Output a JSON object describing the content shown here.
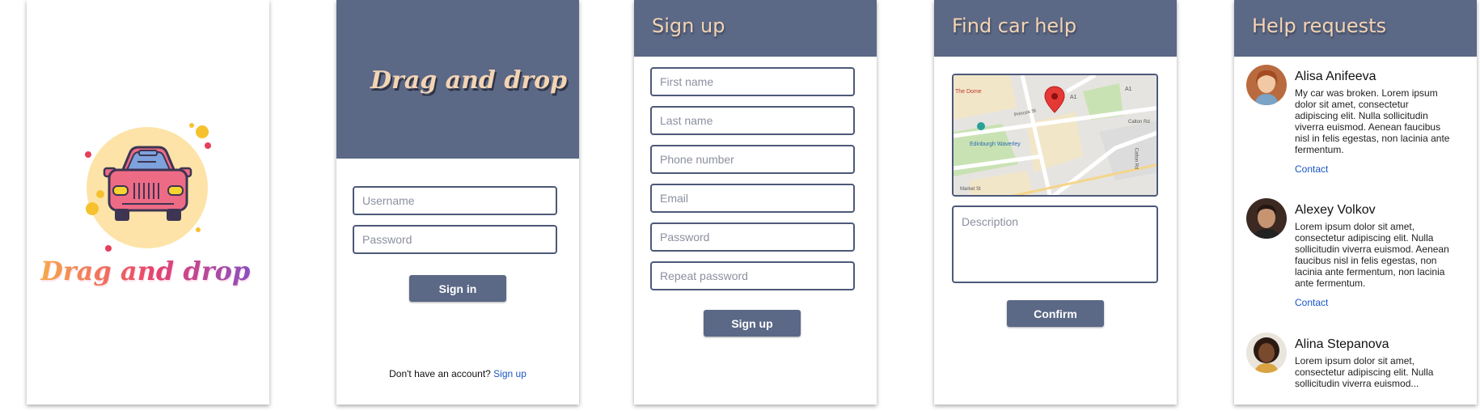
{
  "splash": {
    "brand": "Drag and drop",
    "logo_icon": "car-icon"
  },
  "login": {
    "brand": "Drag and drop",
    "username_placeholder": "Username",
    "password_placeholder": "Password",
    "sign_in_label": "Sign in",
    "no_account_text": "Don't have an account?",
    "sign_up_link": "Sign up"
  },
  "signup": {
    "title": "Sign up",
    "first_name_placeholder": "First name",
    "last_name_placeholder": "Last name",
    "phone_placeholder": "Phone number",
    "email_placeholder": "Email",
    "password_placeholder": "Password",
    "repeat_password_placeholder": "Repeat password",
    "submit_label": "Sign up"
  },
  "find_help": {
    "title": "Find car help",
    "map": {
      "labels": [
        "The Dome",
        "Edinburgh Waverley",
        "Princes St",
        "Market St",
        "A1",
        "A1",
        "Calton Rd",
        "Calton Rd"
      ],
      "marker": "map-pin-icon"
    },
    "description_placeholder": "Description",
    "confirm_label": "Confirm"
  },
  "requests": {
    "title": "Help requests",
    "items": [
      {
        "name": "Alisa Anifeeva",
        "text": "My car was broken. Lorem ipsum dolor sit amet, consectetur adipiscing elit. Nulla sollicitudin viverra euismod. Aenean faucibus nisl in felis egestas, non lacinia ante fermentum.",
        "link": "Contact"
      },
      {
        "name": "Alexey Volkov",
        "text": "Lorem ipsum dolor sit amet, consectetur adipiscing elit. Nulla sollicitudin viverra euismod. Aenean faucibus nisl in felis egestas, non lacinia ante fermentum, non lacinia ante fermentum.",
        "link": "Contact"
      },
      {
        "name": "Alina Stepanova",
        "text": "Lorem ipsum dolor sit amet, consectetur adipiscing elit. Nulla sollicitudin viverra euismod...",
        "link": ""
      }
    ]
  },
  "colors": {
    "header": "#5b6886",
    "title_text": "#f3d4b4",
    "field_border": "#4d5979",
    "link": "#1a56c4"
  }
}
